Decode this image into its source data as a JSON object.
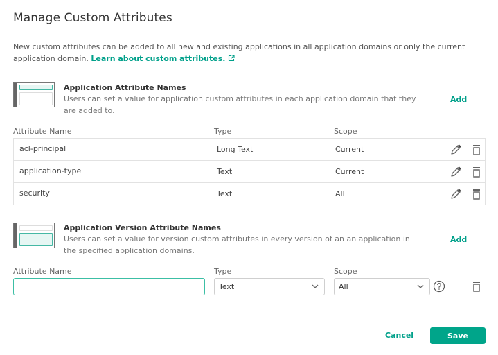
{
  "title": "Manage Custom Attributes",
  "intro": {
    "text": "New custom attributes can be added to all new and existing applications in all application domains or only the current application domain. ",
    "link": "Learn about custom attributes.",
    "link_icon": "external-link-icon"
  },
  "app_section": {
    "title": "Application Attribute Names",
    "description": "Users can set a value for application custom attributes in each application domain that they are added to.",
    "add_label": "Add",
    "columns": [
      "Attribute Name",
      "Type",
      "Scope"
    ],
    "rows": [
      {
        "name": "acl-principal",
        "type": "Long Text",
        "scope": "Current"
      },
      {
        "name": "application-type",
        "type": "Text",
        "scope": "Current"
      },
      {
        "name": "security",
        "type": "Text",
        "scope": "All"
      }
    ],
    "row_icons": [
      "pencil-icon",
      "trash-icon"
    ]
  },
  "version_section": {
    "title": "Application Version Attribute Names",
    "description": "Users can set a value for version custom attributes in every version of an an application in the specified application domains.",
    "add_label": "Add",
    "columns": [
      "Attribute Name",
      "Type",
      "Scope"
    ],
    "new_row": {
      "name_value": "",
      "name_placeholder": "",
      "type_value": "Text",
      "scope_value": "All"
    }
  },
  "footer": {
    "cancel_label": "Cancel",
    "save_label": "Save"
  },
  "colors": {
    "accent": "#00a58a",
    "link": "#00a08a"
  }
}
